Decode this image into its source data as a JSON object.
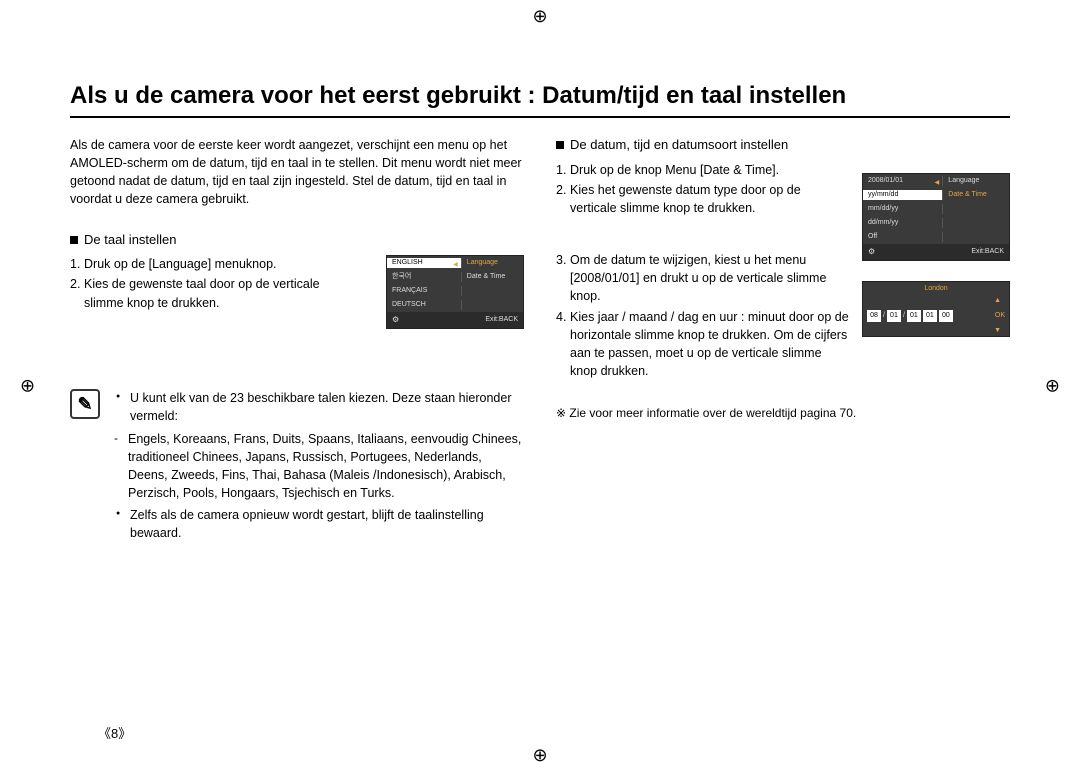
{
  "page_number": "《8》",
  "title": "Als u de camera voor het eerst gebruikt : Datum/tijd en taal instellen",
  "intro": "Als de camera voor de eerste keer wordt aangezet, verschijnt een menu op het AMOLED-scherm om de datum, tijd en taal in te stellen. Dit menu wordt niet meer getoond nadat de datum, tijd en taal zijn ingesteld. Stel de datum, tijd en taal in voordat u deze camera gebruikt.",
  "left": {
    "subhead": "De taal instellen",
    "steps": [
      "Druk op de [Language] menuknop.",
      "Kies de gewenste taal door op de verticale slimme knop te drukken."
    ],
    "screen": {
      "rows": [
        {
          "l": "ENGLISH",
          "r": "Language",
          "sel": true,
          "r_orange": true,
          "tri": true
        },
        {
          "l": "한국어",
          "r": "Date & Time"
        },
        {
          "l": "FRANÇAIS",
          "r": ""
        },
        {
          "l": "DEUTSCH",
          "r": ""
        }
      ],
      "footer_right": "Exit:BACK"
    },
    "note_bullets": [
      "U kunt elk van de 23 beschikbare talen kiezen. Deze staan hieronder vermeld:",
      "Zelfs als de camera opnieuw wordt gestart, blijft de taalinstelling bewaard."
    ],
    "note_sub": "Engels, Koreaans, Frans, Duits, Spaans, Italiaans, eenvoudig Chinees, traditioneel Chinees, Japans, Russisch, Portugees, Nederlands, Deens, Zweeds, Fins, Thai, Bahasa (Maleis /Indonesisch), Arabisch, Perzisch, Pools, Hongaars, Tsjechisch en Turks."
  },
  "right": {
    "subhead": "De datum, tijd en datumsoort instellen",
    "steps": [
      "Druk op de knop Menu [Date & Time].",
      "Kies het gewenste datum type door op de verticale slimme knop te drukken.",
      "Om de datum te wijzigen, kiest u het menu [2008/01/01] en drukt u op de verticale slimme knop.",
      "Kies jaar / maand / dag en uur : minuut door op de horizontale slimme knop te drukken. Om de cijfers aan te passen, moet u op de verticale slimme knop drukken."
    ],
    "date_screen": {
      "rows": [
        {
          "l": "2008/01/01",
          "r": "Language",
          "tri": true
        },
        {
          "l": "yy/mm/dd",
          "r": "Date & Time",
          "sel": true,
          "r_orange": true
        },
        {
          "l": "mm/dd/yy",
          "r": ""
        },
        {
          "l": "dd/mm/yy",
          "r": ""
        },
        {
          "l": "Off",
          "r": ""
        }
      ],
      "footer_right": "Exit:BACK"
    },
    "time_screen": {
      "city": "London",
      "digits": [
        "08",
        "01",
        "01",
        "01",
        "00"
      ],
      "seps": [
        "/",
        "/",
        "",
        "",
        ""
      ],
      "ok": "OK"
    },
    "footnote": "Zie voor meer informatie over de wereldtijd pagina 70."
  }
}
